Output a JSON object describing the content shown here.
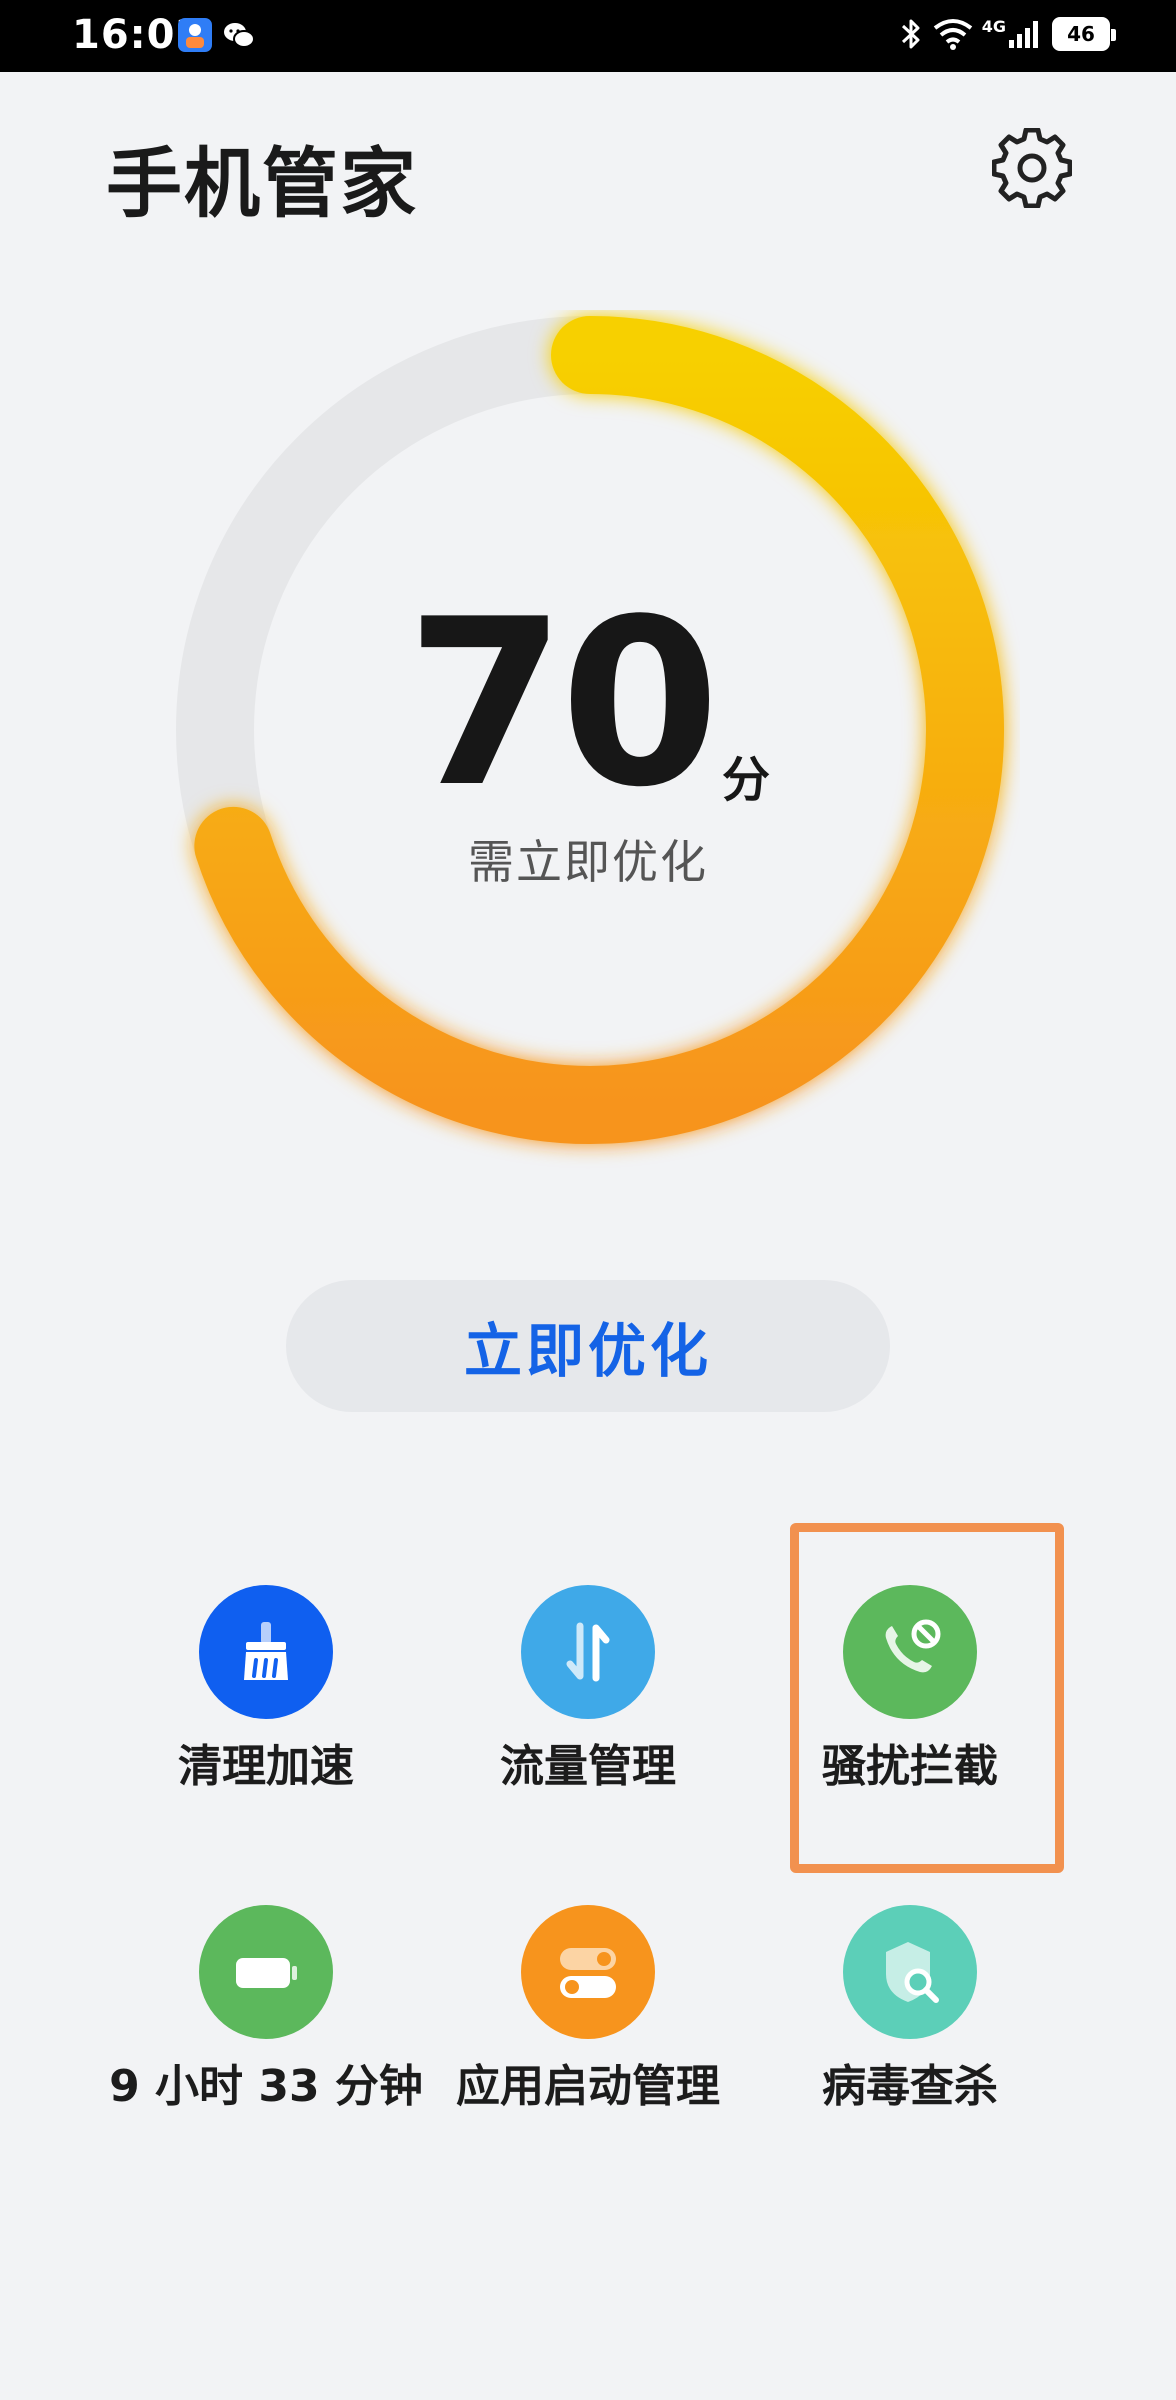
{
  "status_bar": {
    "time": "16:02",
    "signal_label": "4G",
    "battery_level": "46"
  },
  "header": {
    "title": "手机管家"
  },
  "score": {
    "value": "70",
    "unit": "分",
    "status": "需立即优化",
    "fraction": 0.7,
    "color_start": "#f7d000",
    "color_end": "#f7941d",
    "track_color": "#e6e7e9"
  },
  "optimize_button": {
    "label": "立即优化",
    "color": "#1463e6"
  },
  "features": [
    {
      "label": "清理加速",
      "icon": "broom-icon",
      "color": "#0f5ff0"
    },
    {
      "label": "流量管理",
      "icon": "data-transfer-icon",
      "color": "#3fa9e8"
    },
    {
      "label": "骚扰拦截",
      "icon": "call-block-icon",
      "color": "#5cb85c"
    },
    {
      "label": "9 小时 33 分钟",
      "icon": "battery-icon",
      "color": "#5cb85c"
    },
    {
      "label": "应用启动管理",
      "icon": "toggle-icon",
      "color": "#f7941d"
    },
    {
      "label": "病毒查杀",
      "icon": "shield-scan-icon",
      "color": "#5ccfb8"
    }
  ]
}
